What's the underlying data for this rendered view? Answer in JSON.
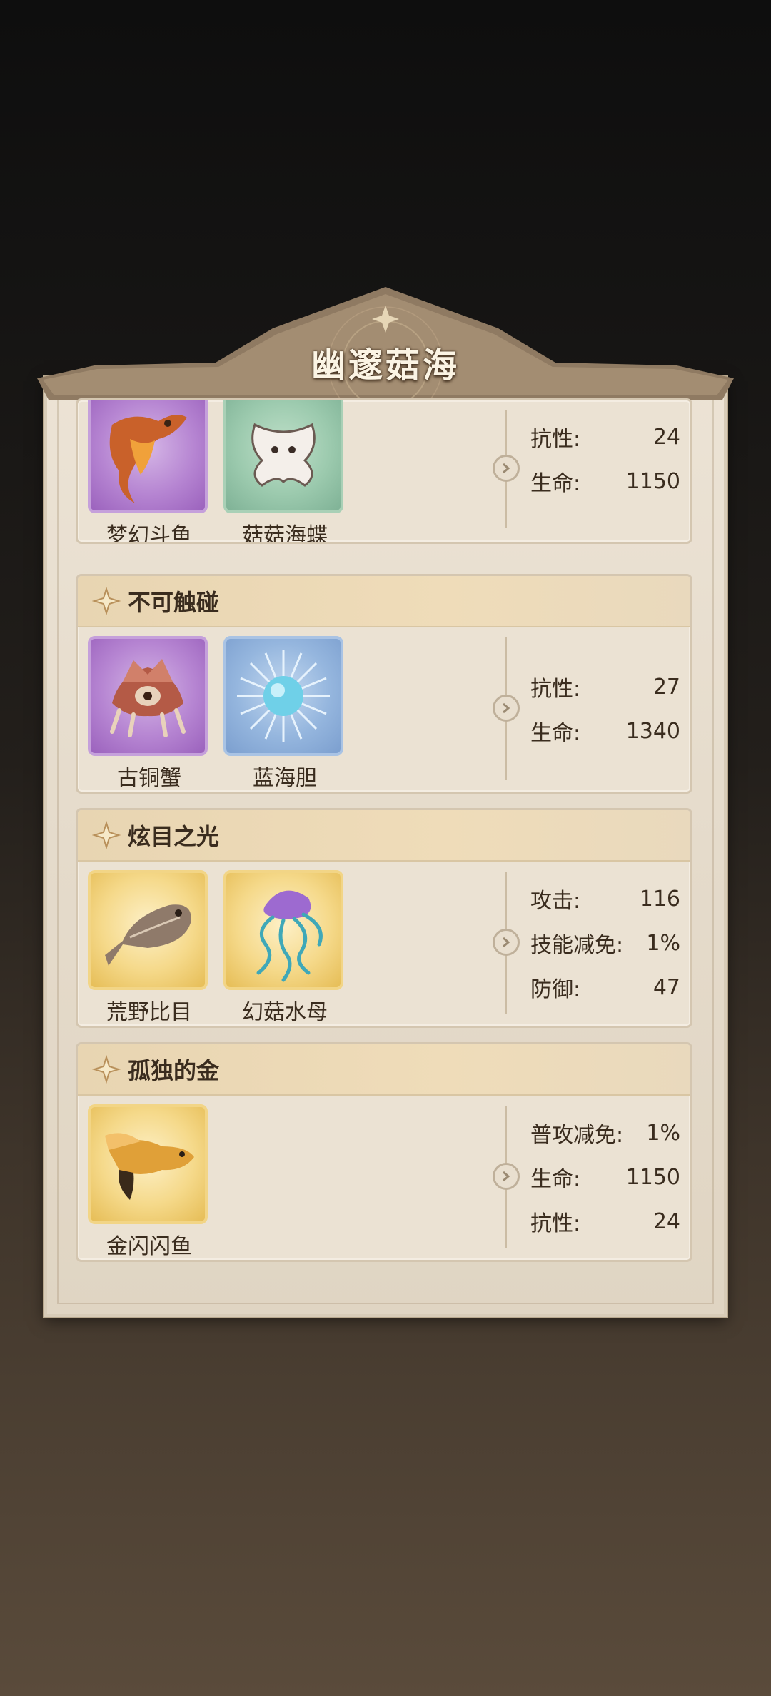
{
  "title": "幽邃菇海",
  "sets": [
    {
      "name": "",
      "items": [
        {
          "name": "梦幻斗鱼",
          "rarity": "purple",
          "icon": "fighting-fish-icon"
        },
        {
          "name": "菇菇海蝶",
          "rarity": "green",
          "icon": "sea-butterfly-icon"
        }
      ],
      "stats": [
        {
          "label": "抗性:",
          "value": "24"
        },
        {
          "label": "生命:",
          "value": "1150"
        }
      ]
    },
    {
      "name": "不可触碰",
      "items": [
        {
          "name": "古铜蟹",
          "rarity": "purple",
          "icon": "bronze-crab-icon"
        },
        {
          "name": "蓝海胆",
          "rarity": "blue",
          "icon": "sea-urchin-icon"
        }
      ],
      "stats": [
        {
          "label": "抗性:",
          "value": "27"
        },
        {
          "label": "生命:",
          "value": "1340"
        }
      ]
    },
    {
      "name": "炫目之光",
      "items": [
        {
          "name": "荒野比目",
          "rarity": "gold",
          "icon": "flatfish-icon"
        },
        {
          "name": "幻菇水母",
          "rarity": "gold",
          "icon": "jellyfish-icon"
        }
      ],
      "stats": [
        {
          "label": "攻击:",
          "value": "116"
        },
        {
          "label": "技能减免:",
          "value": "1%"
        },
        {
          "label": "防御:",
          "value": "47"
        }
      ]
    },
    {
      "name": "孤独的金",
      "items": [
        {
          "name": "金闪闪鱼",
          "rarity": "gold",
          "icon": "goldfish-icon"
        }
      ],
      "stats": [
        {
          "label": "普攻减免:",
          "value": "1%"
        },
        {
          "label": "生命:",
          "value": "1150"
        },
        {
          "label": "抗性:",
          "value": "24"
        }
      ]
    }
  ]
}
